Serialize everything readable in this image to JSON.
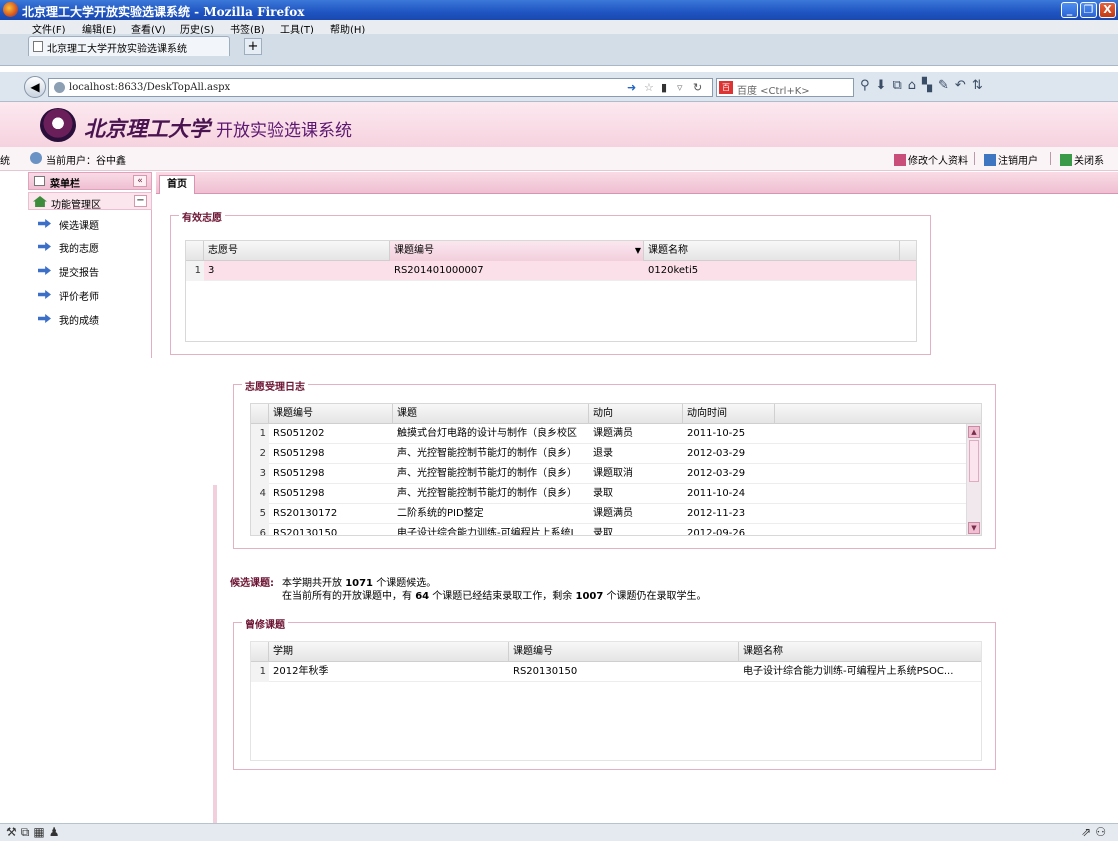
{
  "window": {
    "title": "北京理工大学开放实验选课系统 - Mozilla Firefox",
    "controls": [
      "_",
      "❐",
      "X"
    ]
  },
  "menu": [
    "文件(F)",
    "编辑(E)",
    "查看(V)",
    "历史(S)",
    "书签(B)",
    "工具(T)",
    "帮助(H)"
  ],
  "browser_tab": {
    "label": "北京理工大学开放实验选课系统",
    "new_tab": "+"
  },
  "nav": {
    "url": "localhost:8633/DeskTopAll.aspx",
    "search_engine": "百",
    "search_placeholder": "百度 <Ctrl+K>"
  },
  "header": {
    "university": "北京理工大学",
    "system": "开放实验选课系统"
  },
  "userbar": {
    "cut_text": "统",
    "current_user": "当前用户：谷中鑫",
    "edit_profile": "修改个人资料",
    "logout": "注销用户",
    "close_system": "关闭系"
  },
  "sidebar": {
    "title": "菜单栏",
    "collapse": "«",
    "section": "功能管理区",
    "section_toggle": "−",
    "items": [
      {
        "label": "候选课题"
      },
      {
        "label": "我的志愿"
      },
      {
        "label": "提交报告"
      },
      {
        "label": "评价老师"
      },
      {
        "label": "我的成绩"
      }
    ]
  },
  "content_tab": "首页",
  "valid_wish": {
    "legend": "有效志愿",
    "columns": [
      "志愿号",
      "课题编号",
      "课题名称"
    ],
    "rows": [
      {
        "n": "1",
        "wish_no": "3",
        "code": "RS201401000007",
        "name": "0120keti5"
      }
    ]
  },
  "wish_log": {
    "legend": "志愿受理日志",
    "columns": [
      "课题编号",
      "课题",
      "动向",
      "动向时间"
    ],
    "rows": [
      {
        "n": "1",
        "code": "RS051202",
        "topic": "触摸式台灯电路的设计与制作（良乡校区",
        "action": "课题满员",
        "time": "2011-10-25"
      },
      {
        "n": "2",
        "code": "RS051298",
        "topic": "声、光控智能控制节能灯的制作（良乡）",
        "action": "退录",
        "time": "2012-03-29"
      },
      {
        "n": "3",
        "code": "RS051298",
        "topic": "声、光控智能控制节能灯的制作（良乡）",
        "action": "课题取消",
        "time": "2012-03-29"
      },
      {
        "n": "4",
        "code": "RS051298",
        "topic": "声、光控智能控制节能灯的制作（良乡）",
        "action": "录取",
        "time": "2011-10-24"
      },
      {
        "n": "5",
        "code": "RS20130172",
        "topic": "二阶系统的PID整定",
        "action": "课题满员",
        "time": "2012-11-23"
      },
      {
        "n": "6",
        "code": "RS20130150",
        "topic": "电子设计综合能力训练-可编程片上系统I",
        "action": "录取",
        "time": "2012-09-26"
      }
    ]
  },
  "candidate_info": {
    "label": "候选课题:",
    "line1_pre": "本学期共开放",
    "total": "1071",
    "line1_post": "个课题候选。",
    "line2_pre": "在当前所有的开放课题中，有",
    "closed": "64",
    "line2_mid": "个课题已经结束录取工作，剩余",
    "open": "1007",
    "line2_post": "个课题仍在录取学生。"
  },
  "taken": {
    "legend": "曾修课题",
    "columns": [
      "学期",
      "课题编号",
      "课题名称"
    ],
    "rows": [
      {
        "n": "1",
        "term": "2012年秋季",
        "code": "RS20130150",
        "name": "电子设计综合能力训练-可编程片上系统PSOC..."
      }
    ]
  },
  "toolbar_icons": [
    "search-icon",
    "download-icon",
    "addon-icon",
    "home-icon",
    "back-icon"
  ]
}
